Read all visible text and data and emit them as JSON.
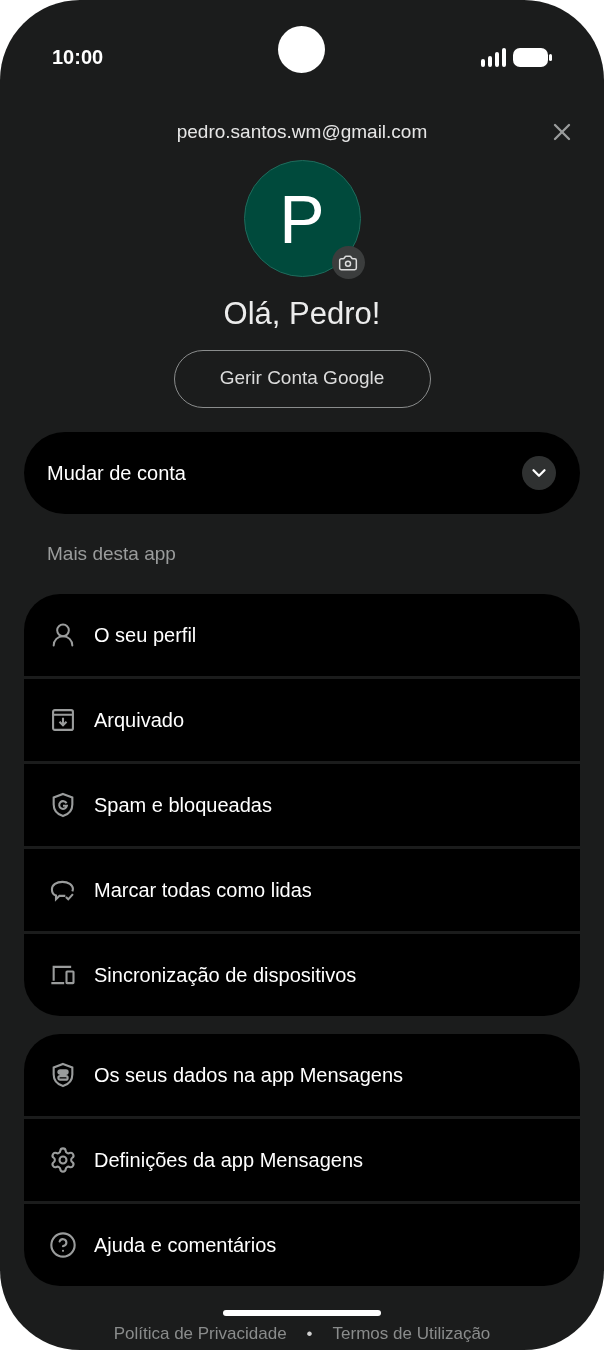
{
  "status_bar": {
    "time": "10:00"
  },
  "account": {
    "email": "pedro.santos.wm@gmail.com",
    "initial": "P",
    "greeting": "Olá, Pedro!",
    "manage_button": "Gerir Conta Google"
  },
  "switch_account": {
    "label": "Mudar de conta",
    "expanded": false
  },
  "section_label": "Mais desta app",
  "groups": [
    [
      {
        "kind": "profile",
        "label": "O seu perfil"
      },
      {
        "kind": "archive",
        "label": "Arquivado"
      },
      {
        "kind": "spam",
        "label": "Spam e bloqueadas"
      },
      {
        "kind": "mark_read",
        "label": "Marcar todas como lidas"
      },
      {
        "kind": "devices",
        "label": "Sincronização de dispositivos"
      }
    ],
    [
      {
        "kind": "data",
        "label": "Os seus dados na app Mensagens"
      },
      {
        "kind": "settings",
        "label": "Definições da app Mensagens"
      },
      {
        "kind": "help",
        "label": "Ajuda e comentários"
      }
    ]
  ],
  "footer": {
    "links": [
      "Política de Privacidade",
      "Termos de Utilização"
    ],
    "separator": "•"
  }
}
